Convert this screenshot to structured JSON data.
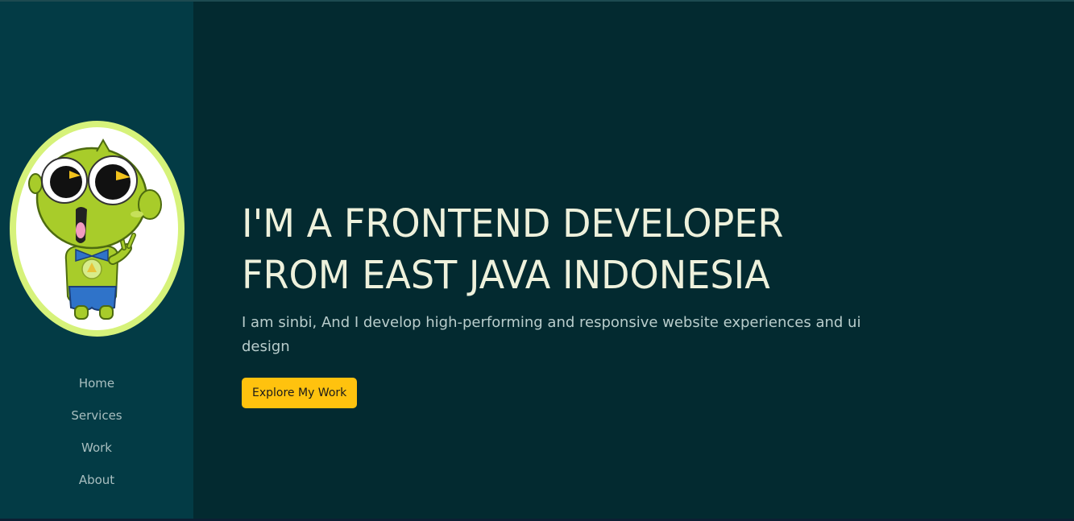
{
  "sidebar": {
    "nav_items": [
      "Home",
      "Services",
      "Work",
      "About"
    ]
  },
  "hero": {
    "headline_line1": "I'M A FRONTEND DEVELOPER",
    "headline_line2": "FROM EAST JAVA INDONESIA",
    "subtitle": "I am sinbi, And I develop high-performing and responsive website experiences and ui design",
    "cta_label": "Explore My Work"
  },
  "colors": {
    "sidebar_bg": "#033b45",
    "main_bg": "#032a30",
    "accent": "#ffc20e",
    "avatar_ring": "#d6f27a",
    "headline": "#eef1dc"
  },
  "icons": {
    "avatar": "green-alien-mascot"
  }
}
